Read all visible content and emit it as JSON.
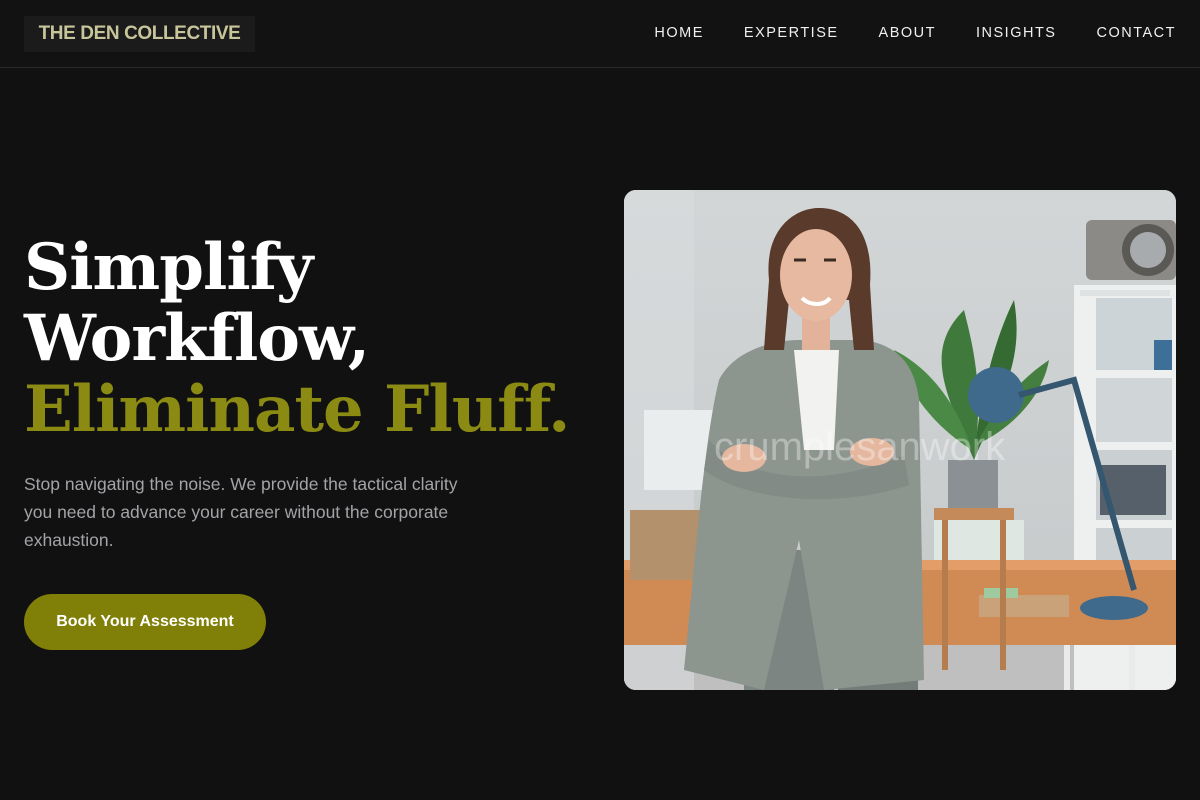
{
  "brand": {
    "name": "THE DEN COLLECTIVE"
  },
  "nav": {
    "items": [
      {
        "label": "HOME"
      },
      {
        "label": "EXPERTISE"
      },
      {
        "label": "ABOUT"
      },
      {
        "label": "INSIGHTS"
      },
      {
        "label": "CONTACT"
      }
    ]
  },
  "hero": {
    "title_line1": "Simplify",
    "title_line2": "Workflow,",
    "title_accent": "Eliminate Fluff.",
    "description": "Stop navigating the noise. We provide the tactical clarity you need to advance your career without the corporate exhaustion.",
    "cta_label": "Book Your Assessment",
    "image_watermark": "crumplesanwork"
  },
  "colors": {
    "background": "#111111",
    "accent": "#808008",
    "accent_text": "#8b8a12",
    "logo_text": "#c8c59a",
    "body_text": "#a3a3a8"
  }
}
